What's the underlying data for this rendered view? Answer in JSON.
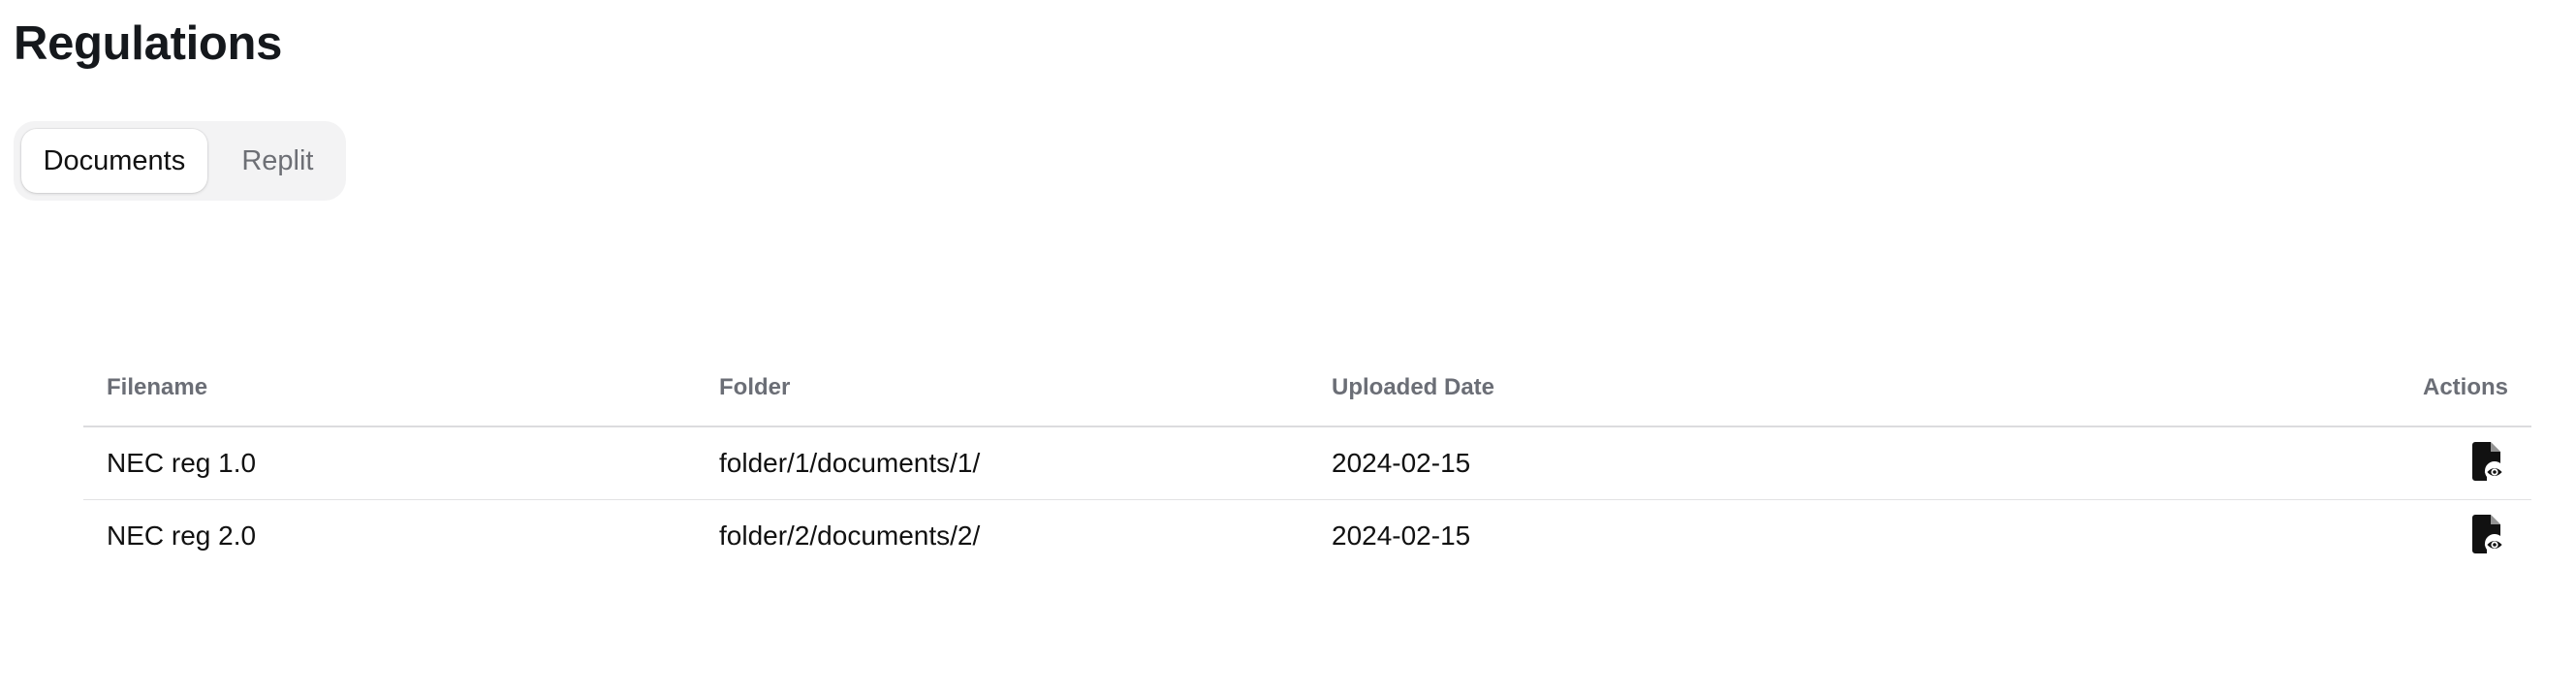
{
  "page": {
    "title": "Regulations"
  },
  "tabs": [
    {
      "label": "Documents",
      "active": true
    },
    {
      "label": "Replit",
      "active": false
    }
  ],
  "table": {
    "headers": {
      "filename": "Filename",
      "folder": "Folder",
      "uploaded_date": "Uploaded Date",
      "actions": "Actions"
    },
    "rows": [
      {
        "filename": "NEC reg 1.0",
        "folder": "folder/1/documents/1/",
        "uploaded_date": "2024-02-15",
        "action_icon": "file-view-icon"
      },
      {
        "filename": "NEC reg 2.0",
        "folder": "folder/2/documents/2/",
        "uploaded_date": "2024-02-15",
        "action_icon": "file-view-icon"
      }
    ]
  },
  "colors": {
    "title": "#15181c",
    "tab_bg": "#f3f3f4",
    "header_text": "#6b6e76",
    "icon": "#111111"
  }
}
